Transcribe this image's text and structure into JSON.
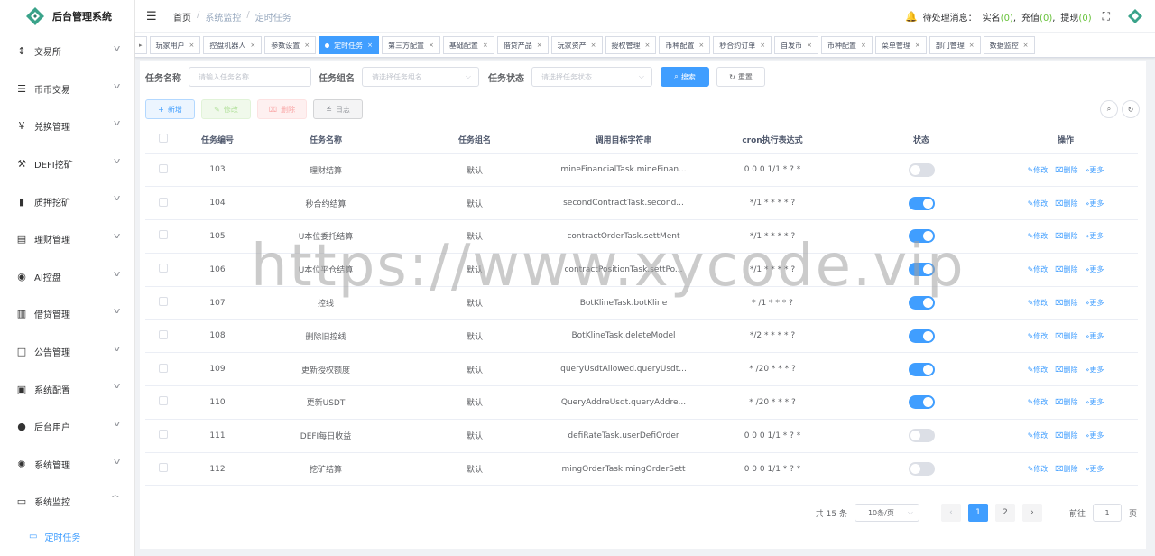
{
  "app": {
    "title": "后台管理系统",
    "brand_color": "#409eff"
  },
  "sidebar": {
    "items": [
      {
        "label": "交易所",
        "icon": "exchange-icon",
        "glyph": "↕"
      },
      {
        "label": "币币交易",
        "icon": "list-icon",
        "glyph": "☰"
      },
      {
        "label": "兑换管理",
        "icon": "yen-icon",
        "glyph": "¥"
      },
      {
        "label": "DEFI挖矿",
        "icon": "pickaxe-icon",
        "glyph": "⚒"
      },
      {
        "label": "质押挖矿",
        "icon": "bar-chart-icon",
        "glyph": "▮"
      },
      {
        "label": "理财管理",
        "icon": "document-icon",
        "glyph": "▤"
      },
      {
        "label": "AI控盘",
        "icon": "robot-icon",
        "glyph": "◉"
      },
      {
        "label": "借贷管理",
        "icon": "book-icon",
        "glyph": "▥"
      },
      {
        "label": "公告管理",
        "icon": "open-book-icon",
        "glyph": "□"
      },
      {
        "label": "系统配置",
        "icon": "config-icon",
        "glyph": "▣"
      },
      {
        "label": "后台用户",
        "icon": "user-icon",
        "glyph": "●"
      },
      {
        "label": "系统管理",
        "icon": "gear-icon",
        "glyph": "✺"
      },
      {
        "label": "系统监控",
        "icon": "monitor-icon",
        "glyph": "▭"
      }
    ],
    "sub_item": {
      "label": "定时任务",
      "icon": "timer-icon",
      "glyph": "▭"
    }
  },
  "header": {
    "breadcrumbs": [
      "首页",
      "系统监控",
      "定时任务"
    ],
    "pending_label": "待处理消息：",
    "realname_label": "实名",
    "realname_count": "0",
    "recharge_label": "充值",
    "recharge_count": "0",
    "withdraw_label": "提现",
    "withdraw_count": "0"
  },
  "tags": [
    {
      "label": "玩家用户",
      "active": false
    },
    {
      "label": "控盘机器人",
      "active": false
    },
    {
      "label": "参数设置",
      "active": false
    },
    {
      "label": "定时任务",
      "active": true
    },
    {
      "label": "第三方配置",
      "active": false
    },
    {
      "label": "基础配置",
      "active": false
    },
    {
      "label": "借贷产品",
      "active": false
    },
    {
      "label": "玩家资产",
      "active": false
    },
    {
      "label": "授权管理",
      "active": false
    },
    {
      "label": "币种配置",
      "active": false
    },
    {
      "label": "秒合约订单",
      "active": false
    },
    {
      "label": "自发币",
      "active": false
    },
    {
      "label": "币种配置",
      "active": false
    },
    {
      "label": "菜单管理",
      "active": false
    },
    {
      "label": "部门管理",
      "active": false
    },
    {
      "label": "数据监控",
      "active": false
    }
  ],
  "filters": {
    "name_label": "任务名称",
    "name_placeholder": "请输入任务名称",
    "group_label": "任务组名",
    "group_placeholder": "请选择任务组名",
    "status_label": "任务状态",
    "status_placeholder": "请选择任务状态",
    "search_label": "搜索",
    "reset_label": "重置"
  },
  "toolbar": {
    "add": "新增",
    "edit": "修改",
    "delete": "删除",
    "log": "日志"
  },
  "table": {
    "columns": [
      "任务编号",
      "任务名称",
      "任务组名",
      "调用目标字符串",
      "cron执行表达式",
      "状态",
      "操作"
    ],
    "rows": [
      {
        "id": "103",
        "name": "理财结算",
        "group": "默认",
        "target": "mineFinancialTask.mineFinan...",
        "cron": "0 0 0 1/1 * ? *",
        "status": false
      },
      {
        "id": "104",
        "name": "秒合约结算",
        "group": "默认",
        "target": "secondContractTask.second...",
        "cron": "*/1 * * * * ?",
        "status": true
      },
      {
        "id": "105",
        "name": "U本位委托结算",
        "group": "默认",
        "target": "contractOrderTask.settMent",
        "cron": "*/1 * * * * ?",
        "status": true
      },
      {
        "id": "106",
        "name": "U本位平仓结算",
        "group": "默认",
        "target": "contractPositionTask.settPo...",
        "cron": "*/1 * * * * ?",
        "status": true
      },
      {
        "id": "107",
        "name": "控线",
        "group": "默认",
        "target": "BotKlineTask.botKline",
        "cron": "* /1 * * * ?",
        "status": true
      },
      {
        "id": "108",
        "name": "删除旧控线",
        "group": "默认",
        "target": "BotKlineTask.deleteModel",
        "cron": "*/2 * * * * ?",
        "status": true
      },
      {
        "id": "109",
        "name": "更新授权额度",
        "group": "默认",
        "target": "queryUsdtAllowed.queryUsdt...",
        "cron": "* /20 * * * ?",
        "status": true
      },
      {
        "id": "110",
        "name": "更新USDT",
        "group": "默认",
        "target": "QueryAddreUsdt.queryAddre...",
        "cron": "* /20 * * * ?",
        "status": true
      },
      {
        "id": "111",
        "name": "DEFI每日收益",
        "group": "默认",
        "target": "defiRateTask.userDefiOrder",
        "cron": "0 0 0 1/1 * ? *",
        "status": false
      },
      {
        "id": "112",
        "name": "挖矿结算",
        "group": "默认",
        "target": "mingOrderTask.mingOrderSett",
        "cron": "0 0 0 1/1 * ? *",
        "status": false
      }
    ],
    "op_edit": "修改",
    "op_delete": "删除",
    "op_more": "更多"
  },
  "pagination": {
    "total_text": "共 15 条",
    "page_size": "10条/页",
    "pages": [
      "1",
      "2"
    ],
    "current": "1",
    "goto_label": "前往",
    "goto_value": "1",
    "page_suffix": "页"
  },
  "watermark": "https://www.xycode.vip"
}
